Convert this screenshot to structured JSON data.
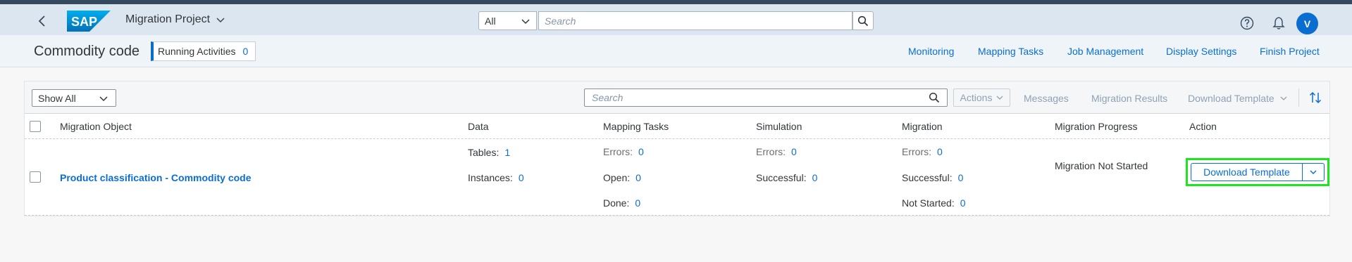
{
  "shell": {
    "logo_text": "SAP",
    "app_title": "Migration Project",
    "search_scope": "All",
    "search_placeholder": "Search",
    "avatar_initial": "V"
  },
  "header": {
    "title": "Commodity code",
    "running_label": "Running Activities",
    "running_count": "0",
    "links": [
      "Monitoring",
      "Mapping Tasks",
      "Job Management",
      "Display Settings",
      "Finish Project"
    ]
  },
  "toolbar": {
    "filter_value": "Show All",
    "search_placeholder": "Search",
    "actions_label": "Actions",
    "messages_label": "Messages",
    "results_label": "Migration Results",
    "download_label": "Download Template"
  },
  "table": {
    "columns": [
      "Migration Object",
      "Data",
      "Mapping Tasks",
      "Simulation",
      "Migration",
      "Migration Progress",
      "Action"
    ],
    "rows": [
      {
        "object": "Product classification - Commodity code",
        "data": {
          "tables_label": "Tables:",
          "tables": "1",
          "instances_label": "Instances:",
          "instances": "0"
        },
        "mapping": {
          "errors_label": "Errors:",
          "errors": "0",
          "open_label": "Open:",
          "open": "0",
          "done_label": "Done:",
          "done": "0"
        },
        "simulation": {
          "errors_label": "Errors:",
          "errors": "0",
          "successful_label": "Successful:",
          "successful": "0"
        },
        "migration": {
          "errors_label": "Errors:",
          "errors": "0",
          "successful_label": "Successful:",
          "successful": "0",
          "not_started_label": "Not Started:",
          "not_started": "0"
        },
        "progress": "Migration Not Started",
        "action": "Download Template"
      }
    ]
  },
  "colors": {
    "accent": "#0a6ed1",
    "shell_bg": "#dbe6f0",
    "highlight": "#1ee61e"
  }
}
